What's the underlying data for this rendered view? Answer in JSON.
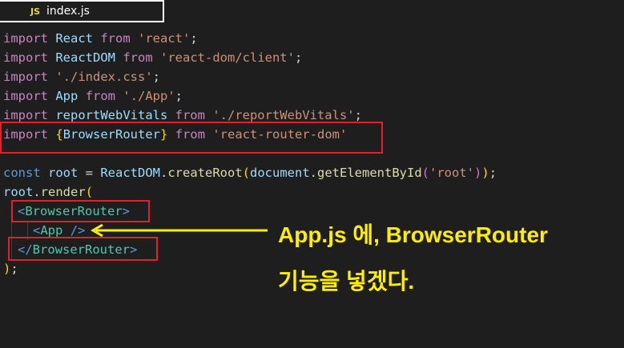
{
  "tab": {
    "icon": "JS",
    "label": "index.js"
  },
  "code": {
    "l1": {
      "kw": "import",
      "name": " React ",
      "from": "from",
      "str": "'react'",
      "end": ";"
    },
    "l2": {
      "kw": "import",
      "name": " ReactDOM ",
      "from": "from",
      "str": "'react-dom/client'",
      "end": ";"
    },
    "l3": {
      "kw": "import",
      "str": "'./index.css'",
      "end": ";"
    },
    "l4": {
      "kw": "import",
      "name": " App ",
      "from": "from",
      "str": "'./App'",
      "end": ";"
    },
    "l5": {
      "kw": "import",
      "name": " reportWebVitals ",
      "from": "from",
      "str": "'./reportWebVitals'",
      "end": ";"
    },
    "l6": {
      "kw": "import",
      "open": "{",
      "name": "BrowserRouter",
      "close": "}",
      "from": "from",
      "str": "'react-router-dom'"
    },
    "l8": {
      "const": "const",
      "root": "root",
      "eq": " = ",
      "obj": "ReactDOM",
      "dot1": ".",
      "fn": "createRoot",
      "p1": "(",
      "doc": "document",
      "dot2": ".",
      "fn2": "getElementById",
      "p2": "(",
      "str": "'root'",
      "p3": ")",
      "p4": ")",
      "end": ";"
    },
    "l9": {
      "root": "root",
      "dot": ".",
      "fn": "render",
      "p": "("
    },
    "l10": {
      "lt": "<",
      "comp": "BrowserRouter",
      "gt": ">"
    },
    "l11": {
      "lt": "<",
      "comp": "App",
      "sp": " ",
      "close": "/>"
    },
    "l12": {
      "lt": "</",
      "comp": "BrowserRouter",
      "gt": ">"
    },
    "l13": {
      "p": ")",
      "end": ";"
    }
  },
  "annotation": {
    "line1": "App.js 에, BrowserRouter",
    "line2": "기능을 넣겠다."
  },
  "colors": {
    "highlight_box": "#e0202a",
    "annotation": "#ffee00"
  }
}
